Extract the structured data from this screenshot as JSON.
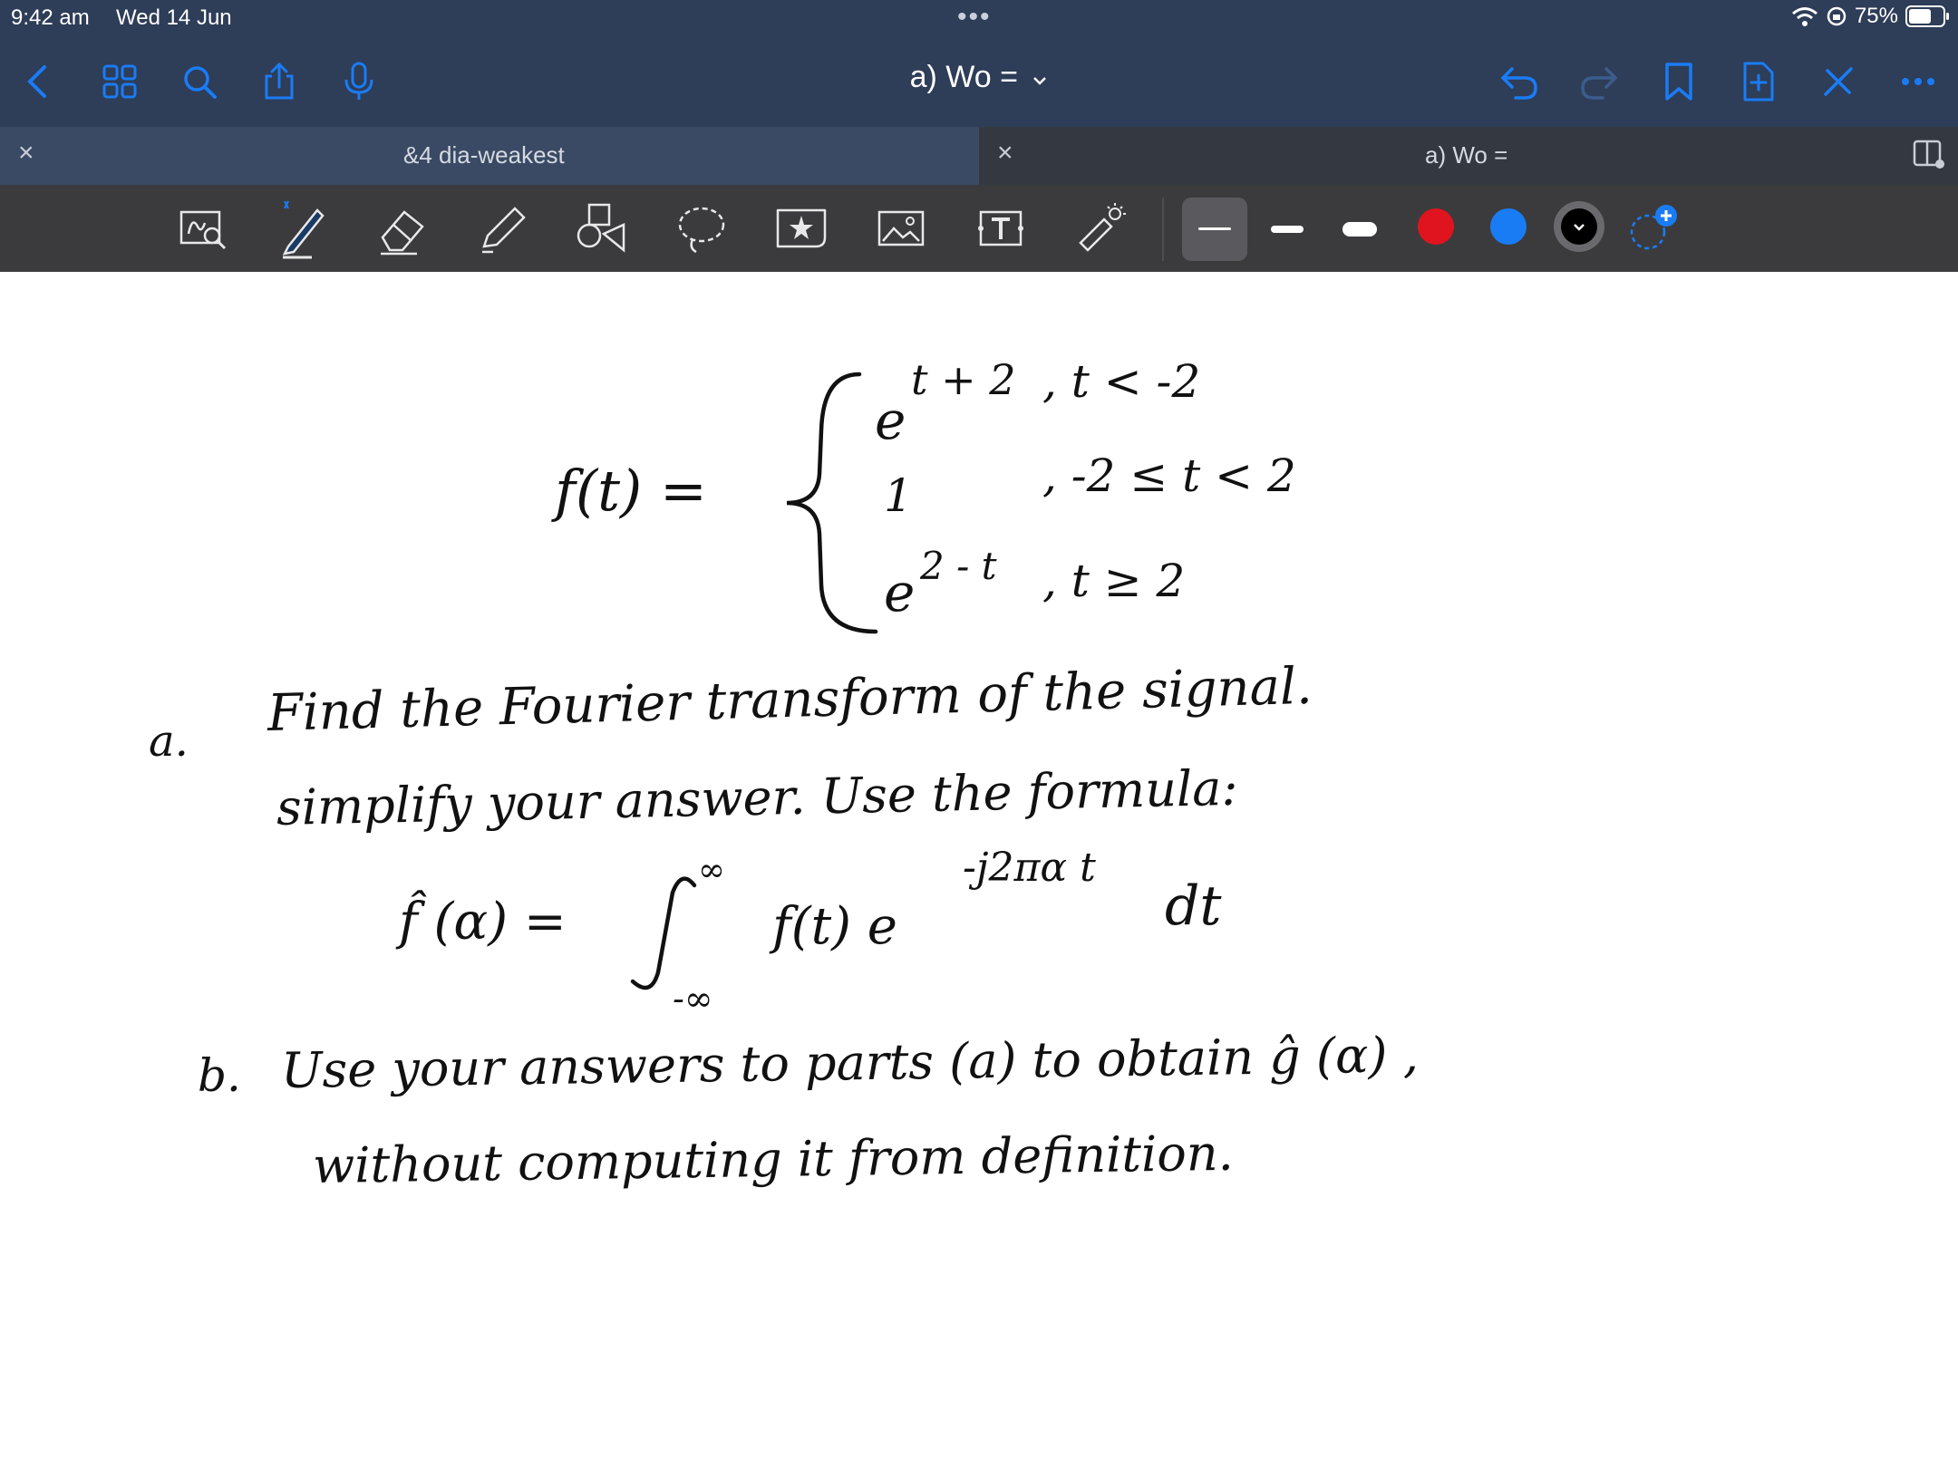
{
  "status_bar": {
    "time": "9:42 am",
    "date": "Wed 14 Jun",
    "battery": "75%",
    "battery_level": 0.75
  },
  "nav": {
    "title": "a) Wo =",
    "title_chevron": "chevron-down-icon"
  },
  "tabs": [
    {
      "label": "&4 dia-weakest",
      "active": true
    },
    {
      "label": "a) Wo =",
      "active": false
    }
  ],
  "toolbar": {
    "tools": [
      "zoom-window-icon",
      "pen-icon",
      "eraser-icon",
      "highlighter-icon",
      "shapes-icon",
      "lasso-icon",
      "sticker-icon",
      "image-icon",
      "text-icon",
      "laser-pointer-icon"
    ],
    "colors": [
      "#e0141e",
      "#1a7cf5",
      "#000000"
    ],
    "selected_color": "#000000",
    "accent": "#1a7cf5"
  },
  "note": {
    "eq_lhs": "f(t) =",
    "case1": "e",
    "case1_exp": "t + 2",
    "case1_cond": ",   t < -2",
    "case2": "1",
    "case2_cond": ",  -2 ≤ t < 2",
    "case3": "e",
    "case3_exp": "2 - t",
    "case3_cond": ",   t ≥ 2",
    "a_label": "a.",
    "a_line1": "Find  the  Fourier  transform  of  the  signal.",
    "a_line2": "simplify  your  answer.  Use  the  formula:",
    "formula_lhs": "f̂ (α) =",
    "int_upper": "∞",
    "int_lower": "-∞",
    "integrand": "f(t) e",
    "integrand_exp": "-j2πα t",
    "dt": "dt",
    "b_label": "b.",
    "b_line1": "Use  your  answers  to  parts  (a)  to  obtain  ĝ (α) ,",
    "b_line2": "without  computing  it  from  definition."
  }
}
